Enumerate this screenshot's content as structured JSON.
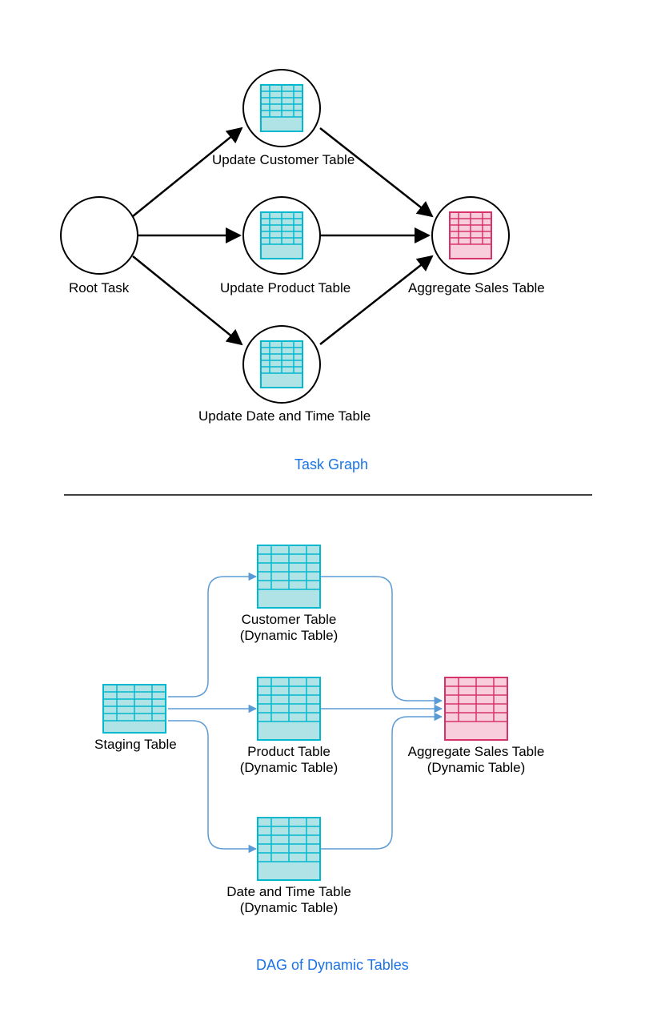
{
  "top": {
    "title": "Task Graph",
    "rootTask": "Root Task",
    "updateCustomer": "Update Customer Table",
    "updateProduct": "Update Product Table",
    "updateDateTime": "Update Date and Time Table",
    "aggregateSales": "Aggregate Sales Table"
  },
  "bottom": {
    "title": "DAG of Dynamic Tables",
    "staging": "Staging Table",
    "customer": "Customer Table\n(Dynamic Table)",
    "product": "Product Table\n(Dynamic Table)",
    "datetime": "Date and Time Table\n(Dynamic Table)",
    "aggregate": "Aggregate Sales Table\n(Dynamic Table)"
  },
  "colors": {
    "cyanStroke": "#01b8ce",
    "cyanFill": "#b0e3e6",
    "pinkStroke": "#d6336c",
    "pinkFill": "#f8cedc",
    "blueText": "#1a73e8",
    "blueArrow": "#5b9bd5"
  }
}
